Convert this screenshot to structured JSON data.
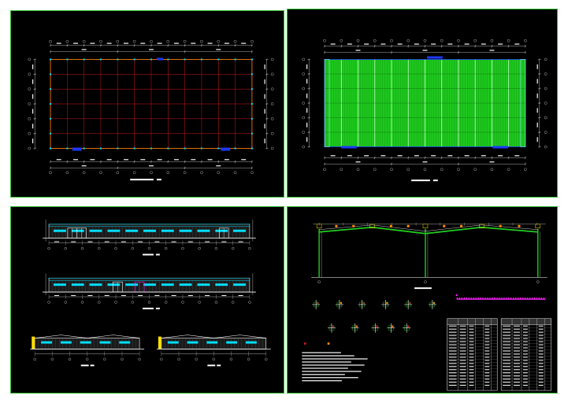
{
  "colors": {
    "background": "#000000",
    "frame": "#2fbf2f",
    "dimension": "#d8d8d8",
    "grid_red": "#d01818",
    "grid_green": "#22cc22",
    "roof_green": "#1ec81e",
    "cyan": "#00e0ff",
    "blue": "#1e38ff",
    "yellow": "#ffe000",
    "magenta": "#ff20ff",
    "orange": "#ff8a00",
    "white": "#ffffff"
  },
  "sheets": [
    {
      "id": "foundation-plan",
      "caption": ""
    },
    {
      "id": "roof-plan",
      "caption": ""
    },
    {
      "id": "elevations",
      "caption": ""
    },
    {
      "id": "portal-frame",
      "caption": ""
    }
  ]
}
